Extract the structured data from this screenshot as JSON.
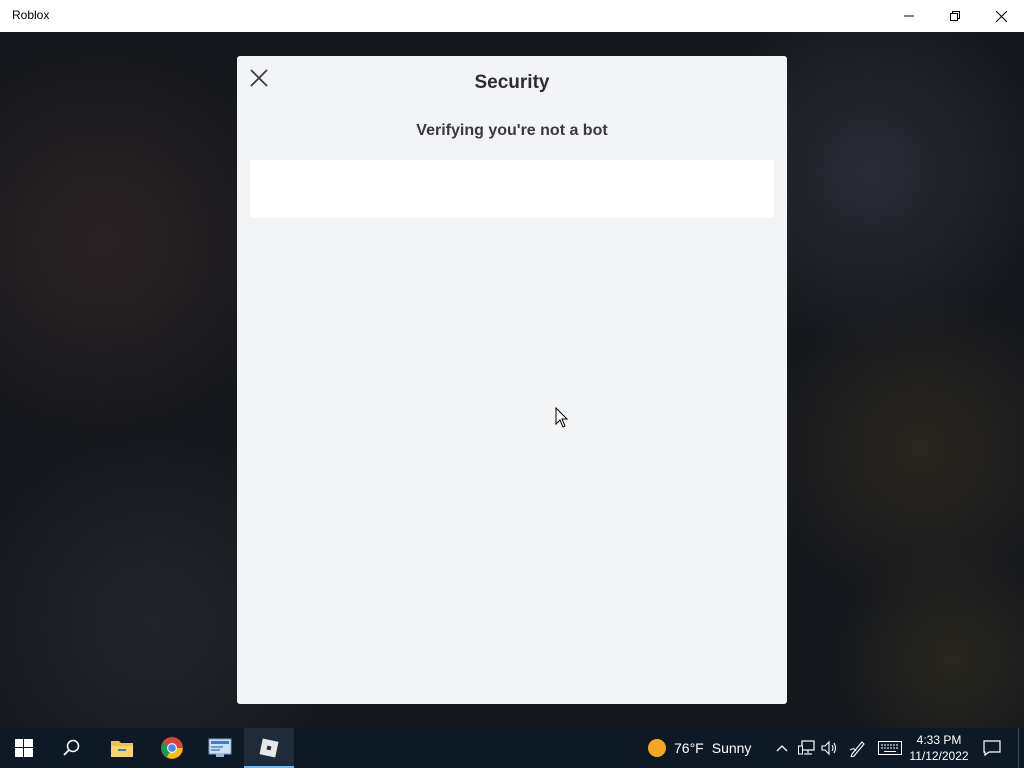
{
  "window": {
    "title": "Roblox"
  },
  "modal": {
    "heading": "Security",
    "subheading": "Verifying you're not a bot"
  },
  "taskbar": {
    "apps": [
      "start-icon",
      "search-icon",
      "file-explorer-icon",
      "chrome-icon",
      "app-icon",
      "roblox-icon"
    ],
    "weather": {
      "temp": "76°F",
      "condition": "Sunny"
    },
    "clock": {
      "time": "4:33 PM",
      "date": "11/12/2022"
    }
  },
  "colors": {
    "modal_bg": "#f2f4f5",
    "taskbar_bg": "#0d1a26",
    "weather_sun": "#f5a623"
  }
}
